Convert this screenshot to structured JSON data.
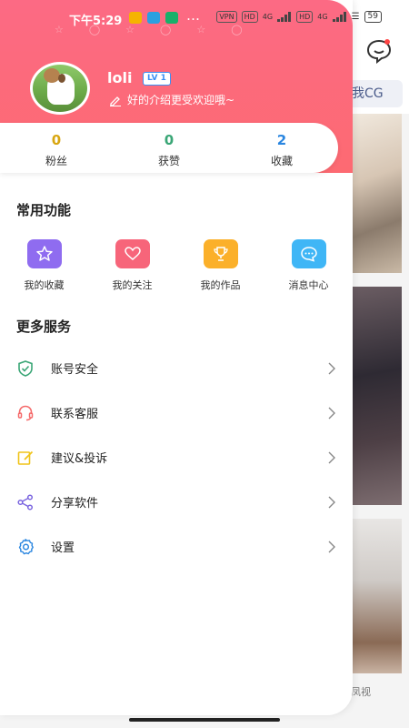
{
  "status_bar": {
    "time": "下午5:29",
    "more": "…",
    "vpn": "VPN",
    "hd1": "HD",
    "net1": "4G",
    "hd2": "HD",
    "net2": "4G",
    "battery": "59"
  },
  "background_app": {
    "tag_label": "我CG",
    "caption": "凤视"
  },
  "profile": {
    "username": "loli",
    "level": "LV 1",
    "intro": "好的介绍更受欢迎哦~"
  },
  "stats": [
    {
      "count": "0",
      "label": "粉丝",
      "color": "#d8a611"
    },
    {
      "count": "0",
      "label": "获赞",
      "color": "#3aa676"
    },
    {
      "count": "2",
      "label": "收藏",
      "color": "#2a86e0"
    }
  ],
  "common_functions": {
    "title": "常用功能",
    "items": [
      {
        "label": "我的收藏",
        "icon": "star-icon",
        "color": "#8f6cf0"
      },
      {
        "label": "我的关注",
        "icon": "heart-icon",
        "color": "#f7657a"
      },
      {
        "label": "我的作品",
        "icon": "trophy-icon",
        "color": "#fbb02a"
      },
      {
        "label": "消息中心",
        "icon": "chat-bubble-icon",
        "color": "#3fb6f6"
      }
    ]
  },
  "more_services": {
    "title": "更多服务",
    "items": [
      {
        "label": "账号安全",
        "icon": "shield-check-icon",
        "color": "#3aa676"
      },
      {
        "label": "联系客服",
        "icon": "headset-icon",
        "color": "#f56a6a"
      },
      {
        "label": "建议&投诉",
        "icon": "edit-icon",
        "color": "#f0c419"
      },
      {
        "label": "分享软件",
        "icon": "share-icon",
        "color": "#7b66e0"
      },
      {
        "label": "设置",
        "icon": "settings-icon",
        "color": "#2a86e0"
      }
    ]
  }
}
